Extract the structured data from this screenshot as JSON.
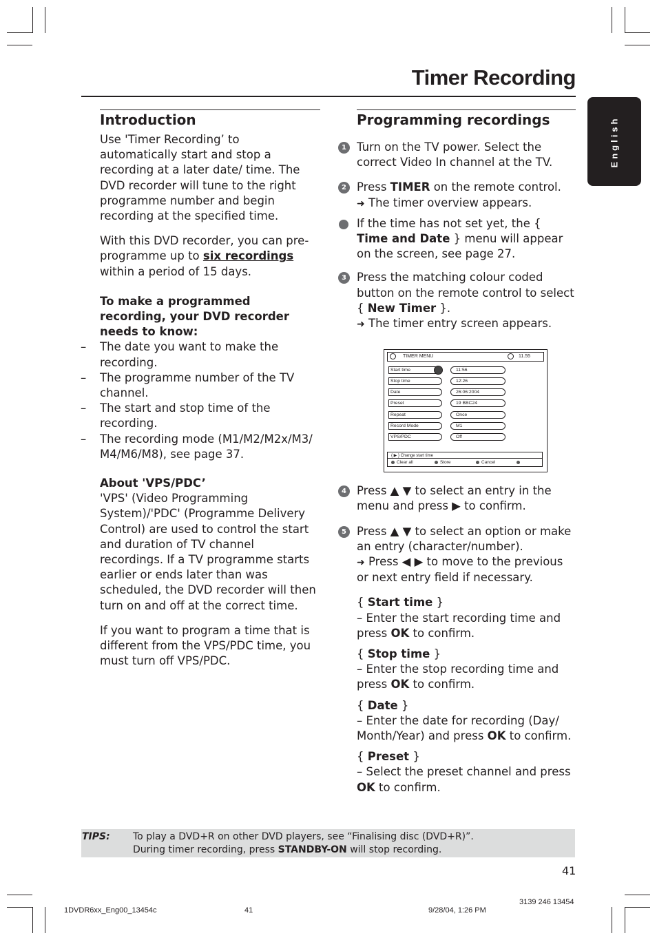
{
  "page_title": "Timer Recording",
  "language_tab": "English",
  "introduction": {
    "heading": "Introduction",
    "para1": "Use 'Timer Recording’ to automatically start and stop a recording at a later date/ time. The DVD recorder will tune to the right programme number and begin recording at the specified time.",
    "para2_pre": "With this DVD recorder, you can pre-programme up to ",
    "para2_bold": "six recordings",
    "para2_post": " within a period of 15 days.",
    "needs_heading": "To make a programmed recording, your DVD recorder needs to know:",
    "needs": [
      "The date you want to make the recording.",
      "The programme number of the TV channel.",
      "The start and stop time of the recording.",
      "The recording mode (M1/M2/M2x/M3/ M4/M6/M8), see page 37."
    ],
    "dash": "–",
    "vps_heading": "About 'VPS/PDC’",
    "vps_para": "'VPS' (Video Programming System)/'PDC' (Programme Delivery Control) are used to control the start and duration of TV channel recordings.  If a TV programme starts earlier or ends later than was scheduled, the DVD recorder will then turn on and off at the correct time.",
    "vps_para2": "If you want to program a time that is different from the VPS/PDC time, you must turn off VPS/PDC."
  },
  "programming": {
    "heading": "Programming recordings",
    "arrow": "➜",
    "steps": [
      {
        "num": "1",
        "text": "Turn on the TV power.  Select the correct Video In channel at the TV."
      },
      {
        "num": "2",
        "pre": "Press ",
        "bold": "TIMER",
        "post": " on the remote control.",
        "result": "The timer overview appears."
      },
      {
        "num": "",
        "pre": "If the time has not set yet, the { ",
        "bold": "Time and Date",
        "post": " } menu will appear on the screen, see page 27."
      },
      {
        "num": "3",
        "pre": "Press the matching colour coded button on the remote control to select { ",
        "bold": "New Timer",
        "post": " }.",
        "result": "The timer entry screen appears."
      },
      {
        "num": "4",
        "text": "Press ▲ ▼ to select an entry in the menu and press ▶ to confirm."
      },
      {
        "num": "5",
        "text": "Press ▲ ▼ to select an option or make an entry (character/number).",
        "result": "Press ◀ ▶ to move to the previous or next entry field if necessary."
      }
    ],
    "options": [
      {
        "name": "Start time",
        "desc_pre": "–  Enter the start recording time and press ",
        "ok": "OK",
        "desc_post": " to confirm."
      },
      {
        "name": "Stop time",
        "desc_pre": "–  Enter the stop recording time and press ",
        "ok": "OK",
        "desc_post": " to confirm."
      },
      {
        "name": "Date",
        "desc_pre": "–  Enter the date for recording (Day/ Month/Year) and press ",
        "ok": "OK",
        "desc_post": " to confirm."
      },
      {
        "name": "Preset",
        "desc_pre": "–  Select the preset channel and press ",
        "ok": "OK",
        "desc_post": " to confirm."
      }
    ],
    "brace_open": "{ ",
    "brace_close": " }"
  },
  "timer_menu": {
    "title": "TIMER MENU",
    "clock": "11.55",
    "rows": [
      {
        "key": "Start time",
        "value": "11:56"
      },
      {
        "key": "Stop time",
        "value": "12:26"
      },
      {
        "key": "Date",
        "value": "26:06:2004"
      },
      {
        "key": "Preset",
        "value": "19 BBC24"
      },
      {
        "key": "Repeat",
        "value": "Once"
      },
      {
        "key": "Record Mode",
        "value": "M1"
      },
      {
        "key": "VPS/PDC",
        "value": "Off"
      }
    ],
    "help": "{ ▶ }  Change start time",
    "buttons": [
      "Clear all",
      "Store",
      "Cancel",
      ""
    ]
  },
  "tips": {
    "label": "TIPS:",
    "line1": "To play a DVD+R on other DVD players, see “Finalising disc (DVD+R)”.",
    "line2_pre": "During timer recording, press ",
    "line2_bold": "STANDBY-ON",
    "line2_post": " will stop recording."
  },
  "page_number": "41",
  "footer": {
    "file": "1DVDR6xx_Eng00_13454c",
    "page": "41",
    "date": "9/28/04, 1:26 PM",
    "code": "3139 246 13454"
  }
}
